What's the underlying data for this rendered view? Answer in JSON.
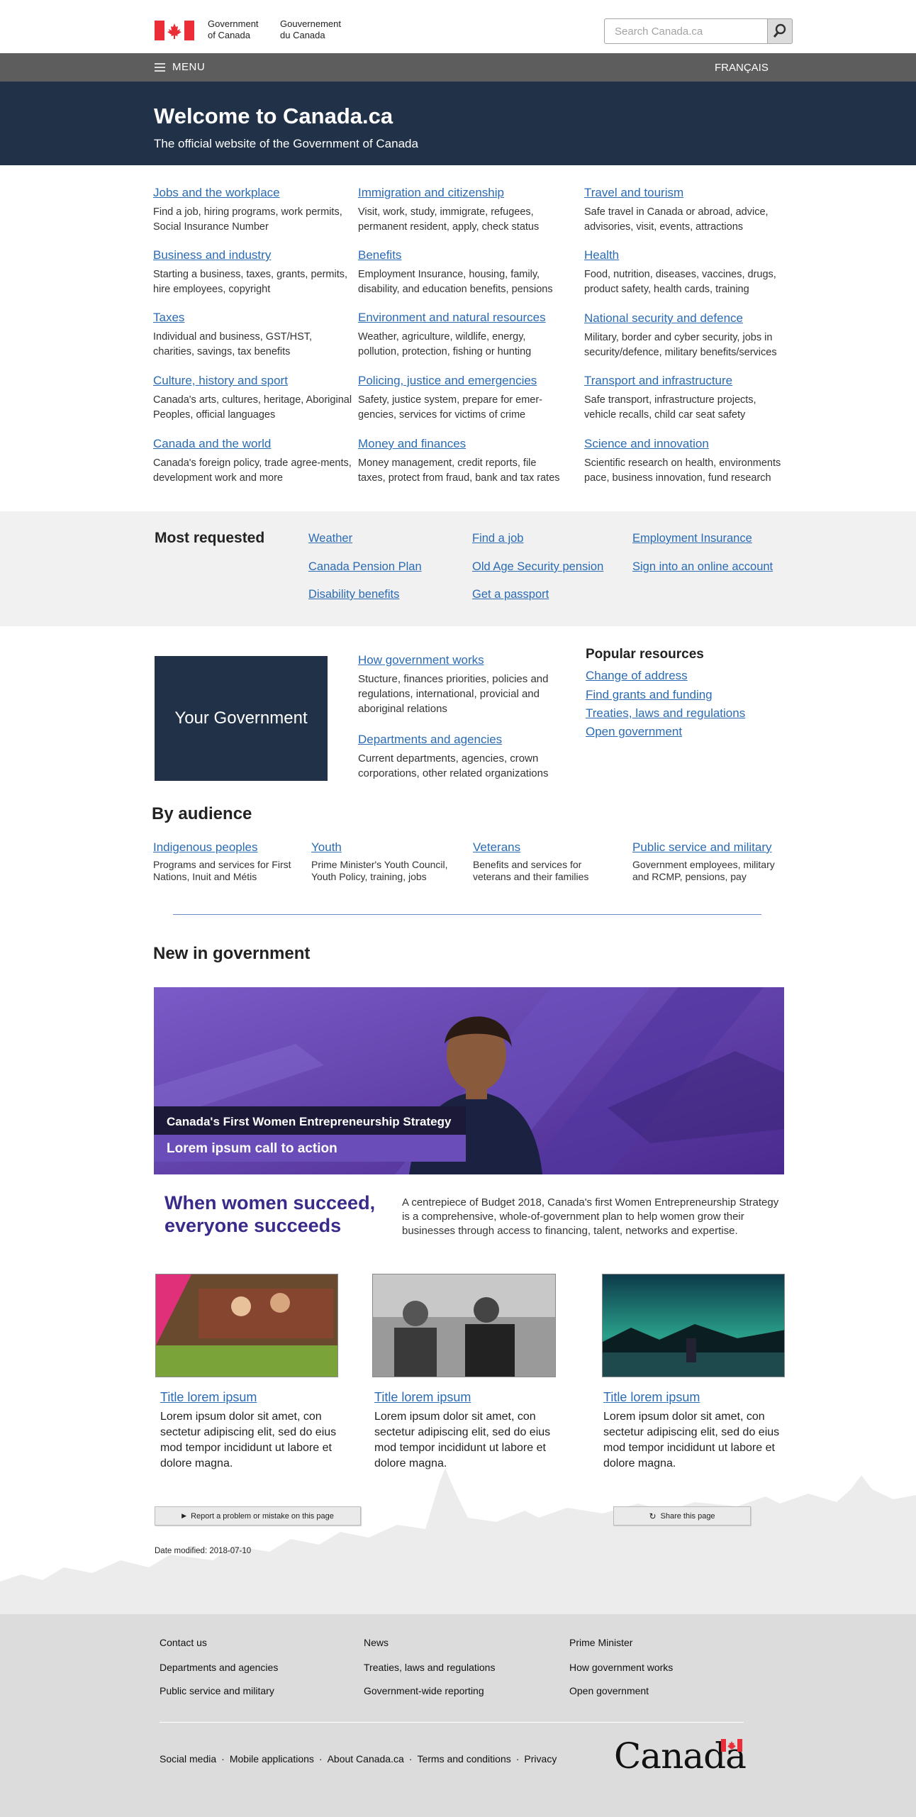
{
  "header": {
    "gov_en_1": "Government",
    "gov_en_2": "of Canada",
    "gov_fr_1": "Gouvernement",
    "gov_fr_2": "du Canada",
    "search_placeholder": "Search Canada.ca",
    "menu_label": "MENU",
    "lang_toggle": "FRANÇAIS"
  },
  "hero": {
    "title": "Welcome to Canada.ca",
    "subtitle": "The official website of the Government of Canada"
  },
  "topics": [
    {
      "title": "Jobs and the workplace",
      "desc": "Find a job, hiring programs, work permits, Social Insurance Number"
    },
    {
      "title": "Immigration and citizenship",
      "desc": "Visit, work, study, immigrate, refugees, permanent resident, apply, check status"
    },
    {
      "title": "Travel and tourism",
      "desc": "Safe travel in Canada or abroad, advice, advisories, visit, events, attractions"
    },
    {
      "title": "Business and industry",
      "desc": "Starting a business, taxes, grants, permits, hire employees, copyright"
    },
    {
      "title": "Benefits",
      "desc": "Employment Insurance, housing, family, disability, and education benefits, pensions"
    },
    {
      "title": "Health",
      "desc": "Food, nutrition, diseases, vaccines, drugs, product safety, health cards, training"
    },
    {
      "title": "Taxes",
      "desc": "Individual and business, GST/HST, charities, savings, tax benefits"
    },
    {
      "title": "Environment and natural resources",
      "desc": "Weather, agriculture, wildlife, energy, pollution, protection, fishing or hunting"
    },
    {
      "title": "National security and defence",
      "desc": "Military, border and cyber security, jobs in security/defence, military benefits/services"
    },
    {
      "title": "Culture, history and sport",
      "desc": "Canada's arts, cultures, heritage, Aboriginal Peoples, official languages"
    },
    {
      "title": "Policing, justice and emergencies",
      "desc": "Safety, justice system, prepare for emer-gencies, services for victims of crime"
    },
    {
      "title": "Transport and infrastructure",
      "desc": "Safe transport, infrastructure projects, vehicle recalls, child car seat safety"
    },
    {
      "title": "Canada and the world",
      "desc": "Canada's foreign policy, trade agree-ments, development work and more"
    },
    {
      "title": "Money and finances",
      "desc": "Money management, credit reports, file taxes, protect from fraud, bank and tax rates"
    },
    {
      "title": "Science and innovation",
      "desc": "Scientific research on health, environments pace, business innovation, fund research"
    }
  ],
  "most_requested": {
    "title": "Most requested",
    "links": [
      "Weather",
      "Find a job",
      "Employment Insurance",
      "Canada Pension Plan",
      "Old Age Security pension",
      "Sign into an online account",
      "Disability benefits",
      "Get a passport"
    ]
  },
  "your_government": {
    "tile": "Your Government",
    "links": [
      {
        "title": "How government works",
        "desc": "Stucture, finances priorities, policies and regulations, international, provicial and aboriginal relations"
      },
      {
        "title": "Departments and agencies",
        "desc": "Current departments, agencies, crown corporations, other related organizations"
      }
    ]
  },
  "popular": {
    "title": "Popular resources",
    "links": [
      "Change of address",
      "Find grants and funding",
      "Treaties, laws and regulations",
      "Open government"
    ]
  },
  "audience": {
    "title": "By audience",
    "items": [
      {
        "title": "Indigenous peoples",
        "desc": "Programs and services for First Nations, Inuit and Métis"
      },
      {
        "title": "Youth",
        "desc": "Prime Minister's Youth Council, Youth Policy, training, jobs"
      },
      {
        "title": "Veterans",
        "desc": "Benefits and services for veterans and their families"
      },
      {
        "title": "Public service and military",
        "desc": "Government employees, military and RCMP, pensions, pay"
      }
    ]
  },
  "new_in_gov": {
    "title": "New in government",
    "feature_label": "Canada's First Women Entrepreneurship Strategy",
    "feature_cta": "Lorem ipsum call to action",
    "headline": "When women succeed, everyone succeeds",
    "description": "A centrepiece of Budget 2018, Canada's first Women Entrepreneurship Strategy is a comprehensive, whole-of-government plan to help women grow their businesses through access to financing, talent, networks and expertise."
  },
  "cards": [
    {
      "title": "Title lorem ipsum",
      "text": "Lorem ipsum dolor sit amet, con sectetur adipiscing elit, sed do eius mod tempor incididunt ut labore et dolore magna."
    },
    {
      "title": "Title lorem ipsum",
      "text": "Lorem ipsum dolor sit amet, con sectetur adipiscing elit, sed do eius mod tempor incididunt ut labore et dolore magna."
    },
    {
      "title": "Title lorem ipsum",
      "text": "Lorem ipsum dolor sit amet, con sectetur adipiscing elit, sed do eius mod tempor incididunt ut labore et dolore magna."
    }
  ],
  "page_actions": {
    "report": "Report a problem or mistake on this page",
    "share": "Share this page",
    "date_modified": "Date modified: 2018-07-10"
  },
  "footer": {
    "links": [
      "Contact us",
      "News",
      "Prime Minister",
      "Departments and agencies",
      "Treaties, laws and regulations",
      "How government works",
      "Public service and military",
      "Government-wide reporting",
      "Open government"
    ],
    "bottom": [
      "Social media",
      "Mobile applications",
      "About Canada.ca",
      "Terms and conditions",
      "Privacy"
    ],
    "separator": "·",
    "wordmark": "Canada"
  },
  "colors": {
    "link": "#2b6bb3",
    "hero_bg": "#213248",
    "menu_bg": "#5d5d5d",
    "flag_red": "#eb2d37",
    "feature_purple": "#5f3fa2",
    "headline_purple": "#3a2a8a"
  }
}
